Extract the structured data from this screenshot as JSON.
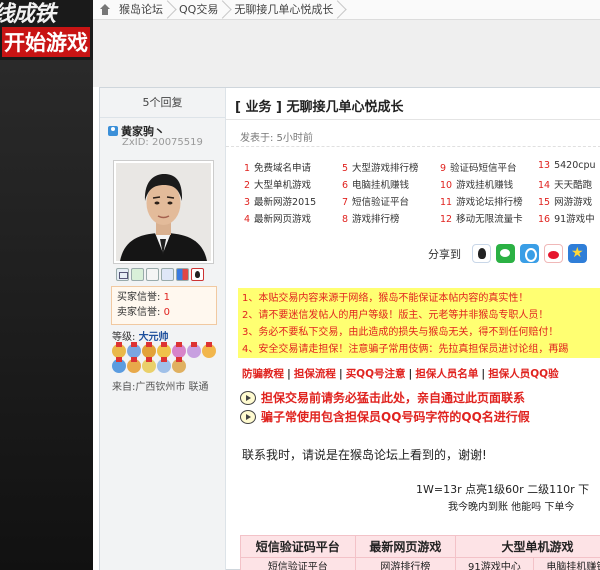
{
  "banner": {
    "line1": "线成铁",
    "line2": "开始游戏"
  },
  "breadcrumb": {
    "items": [
      "猴岛论坛",
      "QQ交易",
      "无聊接几单心悦成长"
    ]
  },
  "sidebar": {
    "reply_count": "5个回复",
    "username": "黄家驹丶",
    "zxid": "ZxID: 20075519",
    "trust": {
      "buyer_label": "买家信誉:",
      "buyer_value": "1",
      "seller_label": "卖家信誉:",
      "seller_value": "0"
    },
    "level_label": "等级:",
    "level_value": "大元帅",
    "from": "来自:广西钦州市 联通"
  },
  "post": {
    "title": "[ 业务 ] 无聊接几单心悦成长",
    "posted_time": "发表于: 5小时前",
    "share_label": "分享到",
    "links": [
      {
        "n": "1",
        "t": "免费域名申请"
      },
      {
        "n": "5",
        "t": "大型游戏排行榜"
      },
      {
        "n": "9",
        "t": "验证码短信平台"
      },
      {
        "n": "13",
        "t": "5420cpu"
      },
      {
        "n": "2",
        "t": "大型单机游戏"
      },
      {
        "n": "6",
        "t": "电脑挂机赚钱"
      },
      {
        "n": "10",
        "t": "游戏挂机赚钱"
      },
      {
        "n": "14",
        "t": "天天酷跑"
      },
      {
        "n": "3",
        "t": "最新网游2015"
      },
      {
        "n": "7",
        "t": "短信验证平台"
      },
      {
        "n": "11",
        "t": "游戏论坛排行榜"
      },
      {
        "n": "15",
        "t": "网游游戏"
      },
      {
        "n": "4",
        "t": "最新网页游戏"
      },
      {
        "n": "8",
        "t": "游戏排行榜"
      },
      {
        "n": "12",
        "t": "移动无限流量卡"
      },
      {
        "n": "16",
        "t": "91游戏中"
      }
    ],
    "notices": [
      "1、本贴交易内容来源于网络，猴岛不能保证本帖内容的真实性！",
      "2、请不要迷信发帖人的用户等级！版主、元老等并非猴岛专职人员！",
      "3、务必不要私下交易，由此造成的损失与猴岛无关，得不到任何赔付！",
      "4、安全交易请走担保！注意骗子常用伎俩：先拉真担保员进讨论组，再踢"
    ],
    "red_links": [
      "防骗教程",
      "担保流程",
      "买QQ号注意",
      "担保人员名单",
      "担保人员QQ验"
    ],
    "warning1": "担保交易前请务必猛击此处，亲自通过此页面联系",
    "warning2": "骗子常使用包含担保员QQ号码字符的QQ名进行假",
    "contact": "联系我时，请说是在猴岛论坛上看到的，谢谢!",
    "price1": "1W=13r  点亮1级60r  二级110r  下",
    "price2": "我今晚内到账  他能吗  下单今"
  },
  "ads": {
    "row1": [
      "短信验证码平台",
      "最新网页游戏",
      "大型单机游戏"
    ],
    "row2": [
      "短信验证平台",
      "网游排行榜",
      "91游戏中心",
      "电脑挂机赚钱"
    ]
  }
}
